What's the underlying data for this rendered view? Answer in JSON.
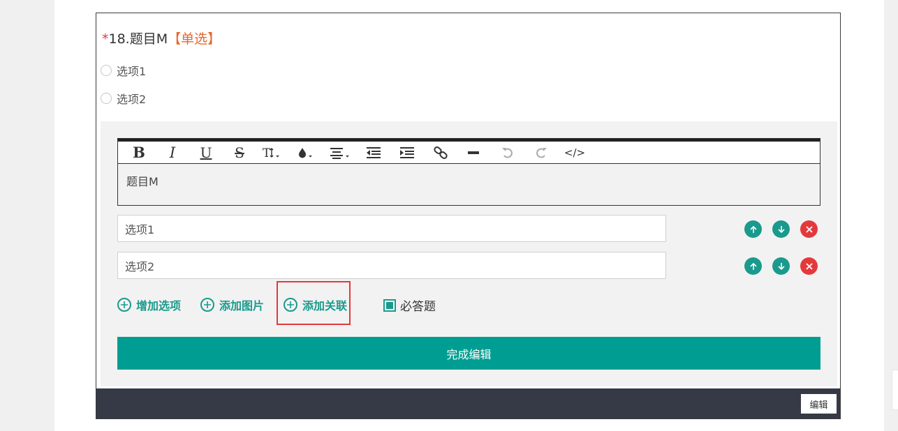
{
  "question": {
    "required_mark": "*",
    "title": "18.题目M",
    "type_label": "【单选】"
  },
  "preview_options": [
    {
      "label": "选项1"
    },
    {
      "label": "选项2"
    }
  ],
  "editor": {
    "toolbar": [
      {
        "name": "bold-icon",
        "glyph": "B"
      },
      {
        "name": "italic-icon",
        "glyph": "I"
      },
      {
        "name": "underline-icon",
        "glyph": "U"
      },
      {
        "name": "strikethrough-icon",
        "glyph": "S"
      },
      {
        "name": "font-size-icon",
        "glyph": "T↕"
      },
      {
        "name": "text-color-icon",
        "glyph": "drop"
      },
      {
        "name": "align-icon",
        "glyph": "align"
      },
      {
        "name": "indent-decrease-icon",
        "glyph": "outdent"
      },
      {
        "name": "indent-increase-icon",
        "glyph": "indent"
      },
      {
        "name": "link-icon",
        "glyph": "link"
      },
      {
        "name": "horizontal-rule-icon",
        "glyph": "hr"
      },
      {
        "name": "undo-icon",
        "glyph": "undo"
      },
      {
        "name": "redo-icon",
        "glyph": "redo"
      },
      {
        "name": "code-icon",
        "glyph": "</>"
      }
    ],
    "content": "题目M"
  },
  "option_inputs": [
    {
      "value": "选项1"
    },
    {
      "value": "选项2"
    }
  ],
  "actions": {
    "add_option": "增加选项",
    "add_image": "添加图片",
    "add_relation": "添加关联",
    "required_label": "必答题",
    "required_checked": true
  },
  "finish_button": "完成编辑",
  "footer": {
    "edit_button": "编辑"
  },
  "colors": {
    "accent": "#009e92",
    "danger": "#e4393c",
    "type_label": "#e8662c",
    "footer": "#363a46"
  }
}
